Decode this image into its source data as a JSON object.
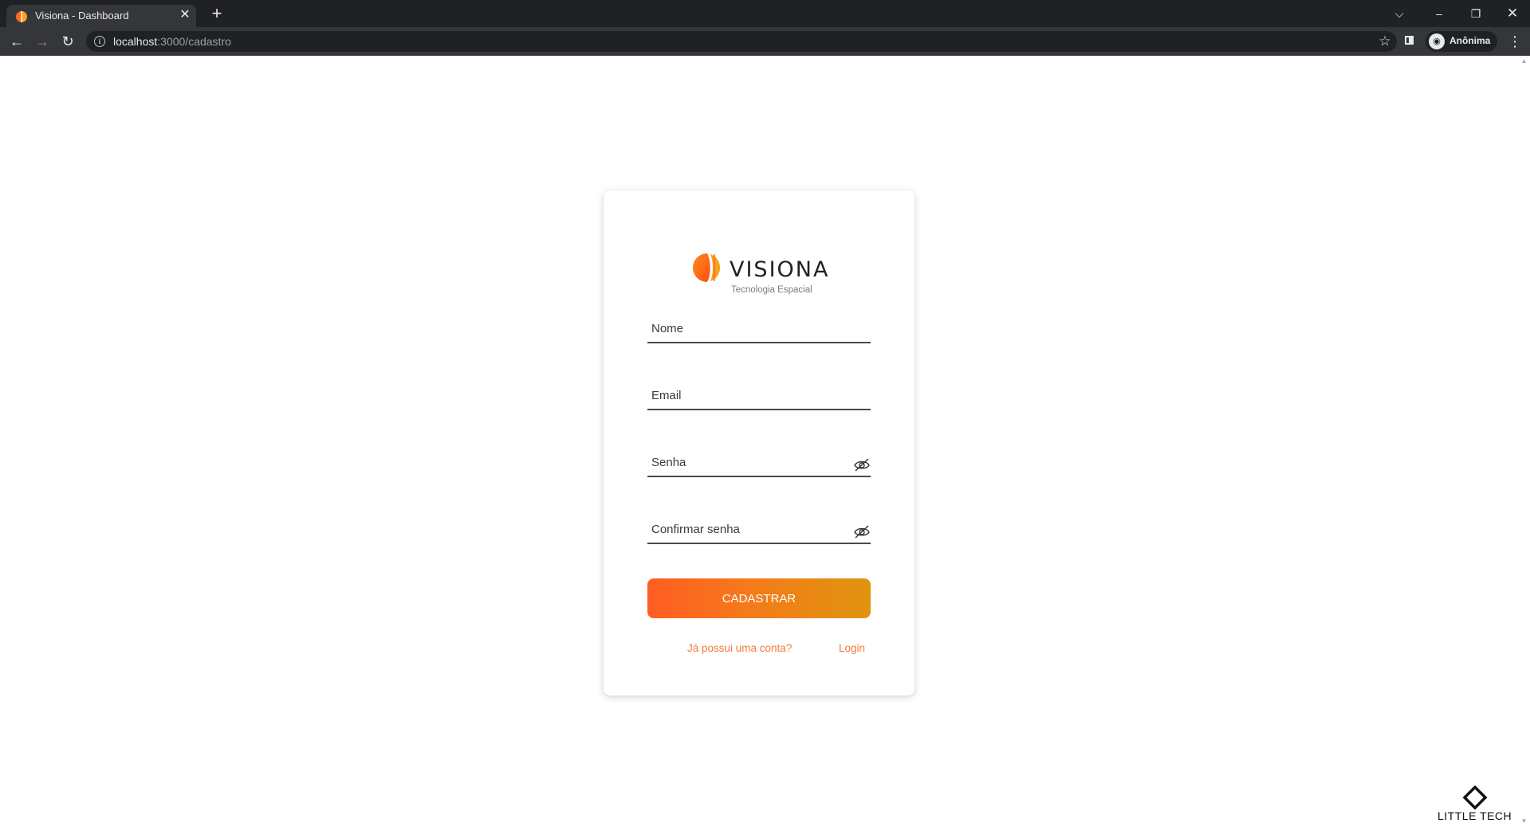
{
  "browser": {
    "tab_title": "Visiona - Dashboard",
    "url_host": "localhost",
    "url_path": ":3000/cadastro",
    "profile_label": "Anônima"
  },
  "logo": {
    "name": "VISIONA",
    "tagline": "Tecnologia Espacial",
    "colors": {
      "primary": "#ff5d1f",
      "secondary": "#f7a21b"
    }
  },
  "form": {
    "name_placeholder": "Nome",
    "email_placeholder": "Email",
    "password_placeholder": "Senha",
    "confirm_password_placeholder": "Confirmar senha",
    "submit_label": "CADASTRAR",
    "has_account_text": "Já possui uma conta?",
    "login_link": "Login"
  },
  "watermark": {
    "text": "LITTLE TECH"
  },
  "colors": {
    "button_gradient_start": "#ff5d22",
    "button_gradient_end": "#e0940f",
    "link": "#f47a36"
  }
}
